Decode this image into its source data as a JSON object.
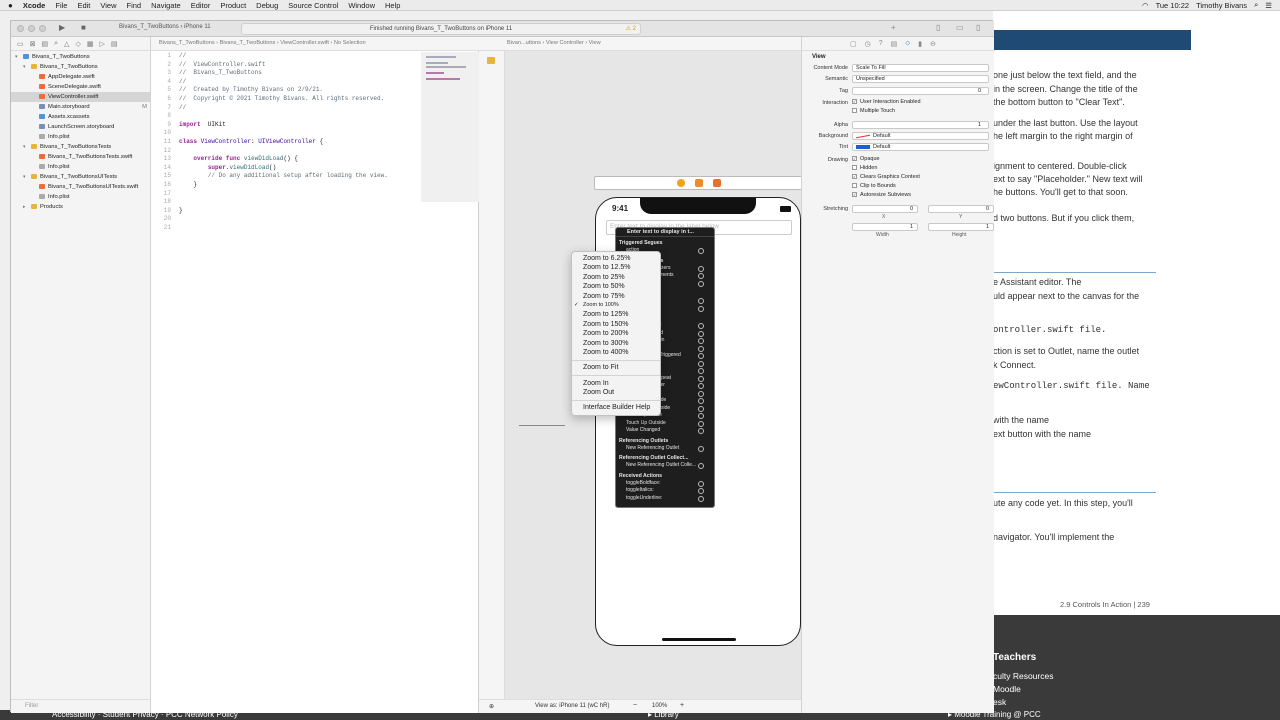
{
  "menubar": {
    "apple": "",
    "app": "Xcode",
    "items": [
      "File",
      "Edit",
      "View",
      "Find",
      "Navigate",
      "Editor",
      "Product",
      "Debug",
      "Source Control",
      "Window",
      "Help"
    ],
    "clock": "Tue 10:22",
    "user": "Timothy Bivans"
  },
  "toolbar": {
    "scheme": "Bivans_T_TwoButtons",
    "device": "iPhone 11",
    "activity": "Finished running Bivans_T_TwoButtons on iPhone 11",
    "warnings": "2"
  },
  "navigator": {
    "items": [
      {
        "label": "Bivans_T_TwoButtons",
        "type": "project",
        "indent": 0,
        "disc": "▾"
      },
      {
        "label": "Bivans_T_TwoButtons",
        "type": "folder",
        "indent": 1,
        "disc": "▾"
      },
      {
        "label": "AppDelegate.swift",
        "type": "swift",
        "indent": 2,
        "disc": ""
      },
      {
        "label": "SceneDelegate.swift",
        "type": "swift",
        "indent": 2,
        "disc": ""
      },
      {
        "label": "ViewController.swift",
        "type": "swift",
        "indent": 2,
        "disc": "",
        "sel": true
      },
      {
        "label": "Main.storyboard",
        "type": "sb",
        "indent": 2,
        "disc": "",
        "mark": "M"
      },
      {
        "label": "Assets.xcassets",
        "type": "asset",
        "indent": 2,
        "disc": ""
      },
      {
        "label": "LaunchScreen.storyboard",
        "type": "sb",
        "indent": 2,
        "disc": ""
      },
      {
        "label": "Info.plist",
        "type": "plist",
        "indent": 2,
        "disc": ""
      },
      {
        "label": "Bivans_T_TwoButtonsTests",
        "type": "folder",
        "indent": 1,
        "disc": "▾"
      },
      {
        "label": "Bivans_T_TwoButtonsTests.swift",
        "type": "swift",
        "indent": 2,
        "disc": ""
      },
      {
        "label": "Info.plist",
        "type": "plist",
        "indent": 2,
        "disc": ""
      },
      {
        "label": "Bivans_T_TwoButtonsUITests",
        "type": "folder",
        "indent": 1,
        "disc": "▾"
      },
      {
        "label": "Bivans_T_TwoButtonsUITests.swift",
        "type": "swift",
        "indent": 2,
        "disc": ""
      },
      {
        "label": "Info.plist",
        "type": "plist",
        "indent": 2,
        "disc": ""
      },
      {
        "label": "Products",
        "type": "folder",
        "indent": 1,
        "disc": "▸"
      }
    ],
    "filter": "Filter"
  },
  "editor": {
    "jumpbar": "Bivans_T_TwoButtons  ›  Bivans_T_TwoButtons  ›  ViewController.swift  ›  No Selection",
    "lines": [
      [
        [
          "cm",
          "//"
        ]
      ],
      [
        [
          "cm",
          "//  ViewController.swift"
        ]
      ],
      [
        [
          "cm",
          "//  Bivans_T_TwoButtons"
        ]
      ],
      [
        [
          "cm",
          "//"
        ]
      ],
      [
        [
          "cm",
          "//  Created by Timothy Bivans on 2/9/21."
        ]
      ],
      [
        [
          "cm",
          "//  Copyright © 2021 Timothy Bivans. All rights reserved."
        ]
      ],
      [
        [
          "cm",
          "//"
        ]
      ],
      [],
      [
        [
          "kw",
          "import"
        ],
        [
          "",
          "  UIKit"
        ]
      ],
      [],
      [
        [
          "kw",
          "class"
        ],
        [
          "",
          " "
        ],
        [
          "ty",
          "ViewController"
        ],
        [
          "",
          ": "
        ],
        [
          "ty",
          "UIViewController"
        ],
        [
          "",
          " {"
        ]
      ],
      [],
      [
        [
          "",
          "    "
        ],
        [
          "kw",
          "override func"
        ],
        [
          "",
          " "
        ],
        [
          "fn",
          "viewDidLoad"
        ],
        [
          "",
          "() {"
        ]
      ],
      [
        [
          "",
          "        "
        ],
        [
          "kw",
          "super"
        ],
        [
          "",
          "."
        ],
        [
          "fn",
          "viewDidLoad"
        ],
        [
          "",
          "()"
        ]
      ],
      [
        [
          "",
          "        "
        ],
        [
          "cm",
          "// Do any additional setup after loading the view."
        ]
      ],
      [
        [
          "",
          "    }"
        ]
      ],
      [],
      [],
      [
        [
          "",
          "}"
        ]
      ],
      [],
      []
    ]
  },
  "assistant": {
    "jumpbar": "Bivan...uttons  ›  View Controller  ›  View",
    "view_as": "View as: iPhone 11 (wC hR)",
    "zoom": "100%"
  },
  "phone": {
    "time": "9:41",
    "placeholder": "Enter text to display in the label below"
  },
  "seg_hud": {
    "title": "Enter text to display in t...",
    "rows": [
      [
        "sec",
        "Triggered Segues"
      ],
      [
        "it",
        "action"
      ],
      [
        "sec",
        "Outlet Collections"
      ],
      [
        "it",
        "gestureRecognizers"
      ],
      [
        "it",
        "accessibilityElements"
      ],
      [
        "it",
        "..."
      ],
      [
        "sec",
        "Outlets"
      ],
      [
        "it",
        "delegate"
      ],
      [
        "it",
        "..."
      ],
      [
        "sec",
        "Sent Events"
      ],
      [
        "it",
        "Did End On Exit"
      ],
      [
        "it",
        "Editing Changed"
      ],
      [
        "it",
        "Editing Did Begin"
      ],
      [
        "it",
        "Editing Did End"
      ],
      [
        "it",
        "Primary Action Triggered"
      ],
      [
        "it",
        "Touch Cancel"
      ],
      [
        "it",
        "Touch Down"
      ],
      [
        "it",
        "Touch Down Repeat"
      ],
      [
        "it",
        "Touch Drag Enter"
      ],
      [
        "it",
        "Touch Drag Exit"
      ],
      [
        "it",
        "Touch Drag Inside"
      ],
      [
        "it",
        "Touch Drag Outside"
      ],
      [
        "it",
        "Touch Up Inside"
      ],
      [
        "it",
        "Touch Up Outside"
      ],
      [
        "it",
        "Value Changed"
      ],
      [
        "sec",
        "Referencing Outlets"
      ],
      [
        "it",
        "New Referencing Outlet"
      ],
      [
        "sec",
        "Referencing Outlet Collect..."
      ],
      [
        "it",
        "New Referencing Outlet Colle..."
      ],
      [
        "sec",
        "Received Actions"
      ],
      [
        "it",
        "toggleBoldface:"
      ],
      [
        "it",
        "toggleItalics:"
      ],
      [
        "it",
        "toggleUnderline:"
      ]
    ]
  },
  "zoom_menu": {
    "items": [
      [
        "Zoom to 6.25%",
        false
      ],
      [
        "Zoom to 12.5%",
        false
      ],
      [
        "Zoom to 25%",
        false
      ],
      [
        "Zoom to 50%",
        false
      ],
      [
        "Zoom to 75%",
        false
      ],
      [
        "Zoom to 100%",
        true
      ],
      [
        "Zoom to 125%",
        false
      ],
      [
        "Zoom to 150%",
        false
      ],
      [
        "Zoom to 200%",
        false
      ],
      [
        "Zoom to 300%",
        false
      ],
      [
        "Zoom to 400%",
        false
      ],
      [
        "-",
        false
      ],
      [
        "Zoom to Fit",
        false
      ],
      [
        "-",
        false
      ],
      [
        "Zoom In",
        false
      ],
      [
        "Zoom Out",
        false
      ],
      [
        "-",
        false
      ],
      [
        "Interface Builder Help",
        false
      ]
    ]
  },
  "inspector": {
    "section": "View",
    "content_mode_label": "Content Mode",
    "content_mode": "Scale To Fill",
    "semantic_label": "Semantic",
    "semantic": "Unspecified",
    "tag_label": "Tag",
    "tag": "0",
    "interaction_label": "Interaction",
    "user_interaction": "User Interaction Enabled",
    "multiple_touch": "Multiple Touch",
    "alpha_label": "Alpha",
    "alpha": "1",
    "background_label": "Background",
    "background": "Default",
    "tint_label": "Tint",
    "tint": "Default",
    "drawing_label": "Drawing",
    "opaque": "Opaque",
    "hidden": "Hidden",
    "clears": "Clears Graphics Context",
    "clip": "Clip to Bounds",
    "autoresize": "Autoresize Subviews",
    "stretching_label": "Stretching",
    "sx": "0",
    "sy": "0",
    "sw": "1",
    "sh": "1",
    "x_label": "X",
    "y_label": "Y",
    "w_label": "Width",
    "h_label": "Height"
  },
  "bg_doc": {
    "lines": [
      "one just below the text field, and the",
      "in the screen. Change the title of the",
      "the bottom button to \"Clear Text\".",
      "under the last button. Use the layout",
      "he left margin to the right margin of",
      "ignment to centered. Double-click",
      "ext to say \"Placeholder.\" New text will",
      "he buttons. You'll get to that soon.",
      "d two buttons. But if you click them,",
      "e Assistant editor. The",
      "uld appear next to the canvas for the",
      "ontroller.swift file.",
      "ction is set to Outlet, name the outlet",
      "k Connect.",
      "ewController.swift file. Name",
      "with the name",
      "ext button with the name",
      "ute any code yet. In this step, you'll",
      "navigator. You'll implement the"
    ],
    "page": "2.9 Controls In Action  |  239"
  },
  "bg_footer": {
    "items": [
      "Teachers",
      "culty Resources",
      "Moodle",
      "esk"
    ],
    "strip_left": "Accessibility · Student Privacy · PCC Network Policy",
    "strip_mid": "▸ Library",
    "strip_right": "▸ Moodle Training @ PCC"
  }
}
